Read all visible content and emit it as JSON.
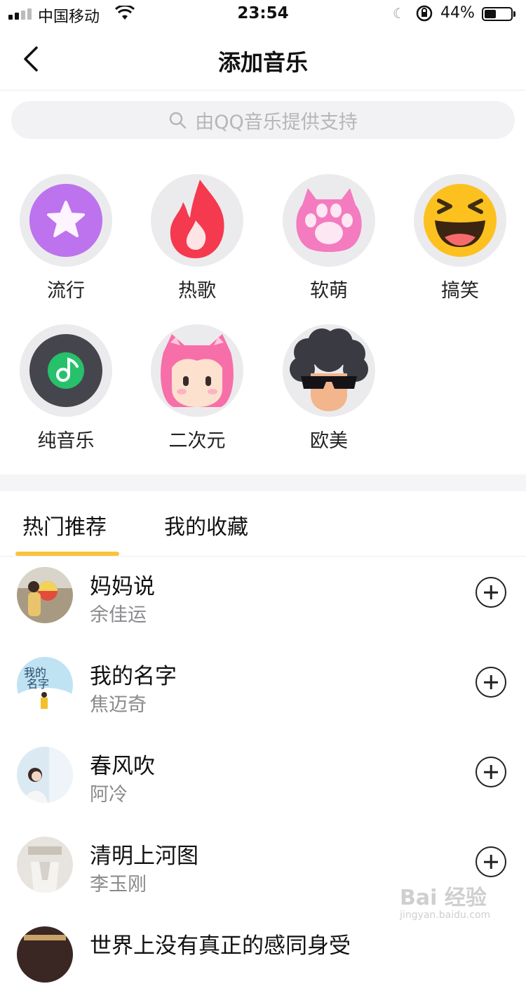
{
  "status": {
    "carrier": "中国移动",
    "time": "23:54",
    "battery_text": "44%",
    "battery_level": 0.44
  },
  "nav": {
    "title": "添加音乐"
  },
  "search": {
    "placeholder": "由QQ音乐提供支持"
  },
  "categories": [
    {
      "label": "流行",
      "icon": "star-icon"
    },
    {
      "label": "热歌",
      "icon": "flame-icon"
    },
    {
      "label": "软萌",
      "icon": "paw-icon"
    },
    {
      "label": "搞笑",
      "icon": "laughing-face-icon"
    },
    {
      "label": "纯音乐",
      "icon": "music-note-icon"
    },
    {
      "label": "二次元",
      "icon": "anime-girl-icon"
    },
    {
      "label": "欧美",
      "icon": "afro-sunglasses-icon"
    }
  ],
  "tabs": [
    "热门推荐",
    "我的收藏"
  ],
  "songs": [
    {
      "title": "妈妈说",
      "artist": "余佳运"
    },
    {
      "title": "我的名字",
      "artist": "焦迈奇"
    },
    {
      "title": "春风吹",
      "artist": "阿冷"
    },
    {
      "title": "清明上河图",
      "artist": "李玉刚"
    },
    {
      "title": "世界上没有真正的感同身受",
      "artist": ""
    }
  ],
  "watermark": {
    "main": "Bai 经验",
    "sub": "jingyan.baidu.com"
  },
  "colors": {
    "accent": "#f7c43b",
    "search_bg": "#f2f2f4"
  }
}
